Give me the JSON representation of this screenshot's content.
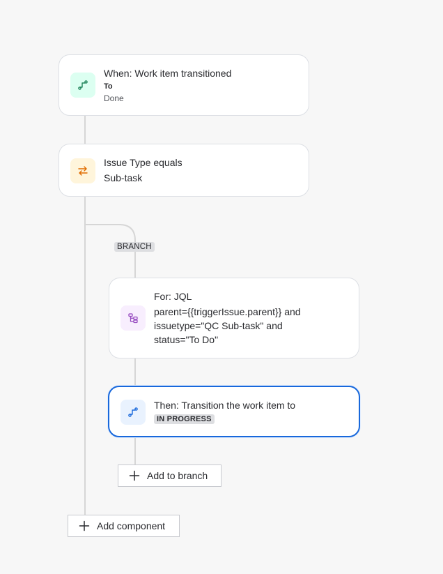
{
  "trigger": {
    "title": "When: Work item transitioned",
    "field_label": "To",
    "field_value": "Done",
    "icon": "trigger-icon",
    "icon_bg": "#dcfff1",
    "icon_color": "#1f845a"
  },
  "condition": {
    "title": "Issue Type equals",
    "value": "Sub-task",
    "icon": "condition-swap-icon",
    "icon_bg": "#fff5db",
    "icon_color": "#e06c00"
  },
  "branch": {
    "tag": "BRANCH",
    "for": {
      "title": "For: JQL",
      "lines": [
        "parent={{triggerIssue.parent}} and",
        "issuetype=\"QC Sub-task\" and",
        "status=\"To Do\""
      ],
      "icon": "branch-icon",
      "icon_bg": "#f8eefe",
      "icon_color": "#964ac0"
    },
    "action": {
      "title": "Then: Transition the work item to",
      "status": "IN PROGRESS",
      "icon": "transition-icon",
      "icon_bg": "#e9f2fe",
      "icon_color": "#1868db",
      "accent": "#1868db"
    },
    "add_button": "Add to branch"
  },
  "add_component_button": "Add component"
}
